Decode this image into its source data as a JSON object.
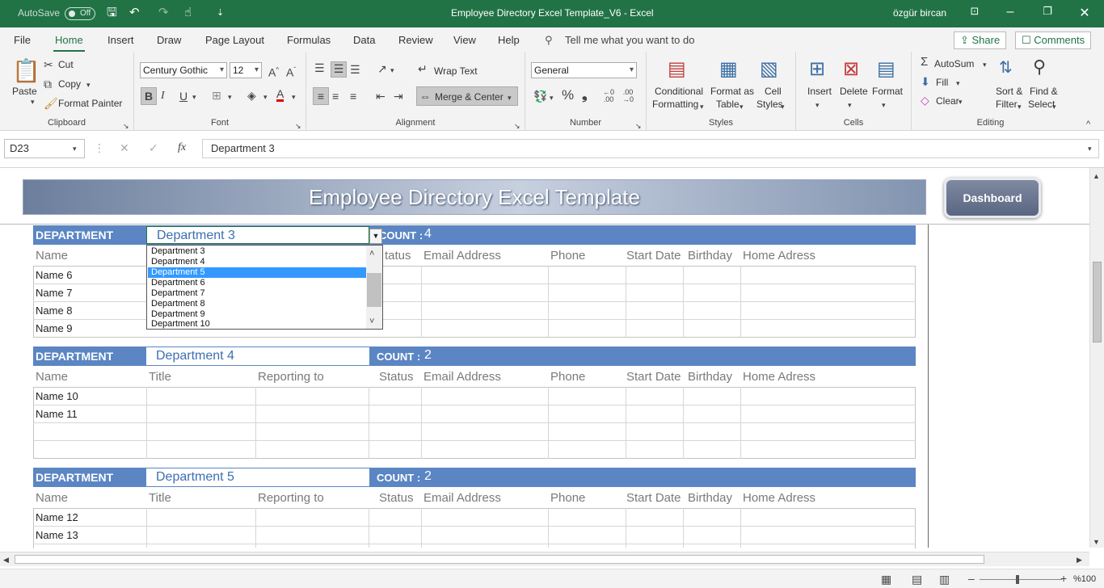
{
  "titlebar": {
    "autosave_label": "AutoSave",
    "autosave_state": "Off",
    "title": "Employee Directory Excel Template_V6  -  Excel",
    "user": "özgür bircan"
  },
  "tabs": [
    {
      "label": "File"
    },
    {
      "label": "Home"
    },
    {
      "label": "Insert"
    },
    {
      "label": "Draw"
    },
    {
      "label": "Page Layout"
    },
    {
      "label": "Formulas"
    },
    {
      "label": "Data"
    },
    {
      "label": "Review"
    },
    {
      "label": "View"
    },
    {
      "label": "Help"
    }
  ],
  "tell_me": "Tell me what you want to do",
  "share_label": "Share",
  "comments_label": "Comments",
  "ribbon": {
    "clipboard": {
      "paste": "Paste",
      "cut": "Cut",
      "copy": "Copy",
      "format_painter": "Format Painter",
      "label": "Clipboard"
    },
    "font": {
      "name": "Century Gothic",
      "size": "12",
      "label": "Font"
    },
    "alignment": {
      "wrap": "Wrap Text",
      "merge": "Merge & Center",
      "label": "Alignment"
    },
    "number": {
      "format": "General",
      "label": "Number"
    },
    "styles": {
      "conditional": "Conditional",
      "conditional2": "Formatting",
      "format_as": "Format as",
      "format_as2": "Table",
      "cell": "Cell",
      "cell2": "Styles",
      "label": "Styles"
    },
    "cells": {
      "insert": "Insert",
      "delete": "Delete",
      "format": "Format",
      "label": "Cells"
    },
    "editing": {
      "autosum": "AutoSum",
      "fill": "Fill",
      "clear": "Clear",
      "sort": "Sort &",
      "sort2": "Filter",
      "find": "Find &",
      "find2": "Select",
      "label": "Editing"
    }
  },
  "formula_bar": {
    "cell_ref": "D23",
    "content": "Department 3"
  },
  "sheet": {
    "banner_title": "Employee Directory Excel Template",
    "dashboard_label": "Dashboard",
    "dept_label": "DEPARTMENT",
    "count_label": "COUNT :",
    "headers": [
      "Name",
      "Title",
      "Reporting to",
      "Status",
      "Email Address",
      "Phone",
      "Start Date",
      "Birthday",
      "Home Adress"
    ],
    "blocks": [
      {
        "department": "Department 3",
        "count": "4",
        "rows": [
          "Name 6",
          "Name 7",
          "Name 8",
          "Name 9"
        ]
      },
      {
        "department": "Department 4",
        "count": "2",
        "rows": [
          "Name 10",
          "Name 11",
          "",
          ""
        ]
      },
      {
        "department": "Department 5",
        "count": "2",
        "rows": [
          "Name 12",
          "Name 13"
        ]
      }
    ],
    "block1_visible_headers": [
      "Name",
      "tatus",
      "Email Address",
      "Phone",
      "Start Date",
      "Birthday",
      "Home Adress"
    ]
  },
  "dropdown": {
    "options": [
      "Department 3",
      "Department 4",
      "Department 5",
      "Department 6",
      "Department 7",
      "Department 8",
      "Department 9",
      "Department 10"
    ],
    "highlighted_index": 2
  },
  "status": {
    "zoom": "%100"
  }
}
